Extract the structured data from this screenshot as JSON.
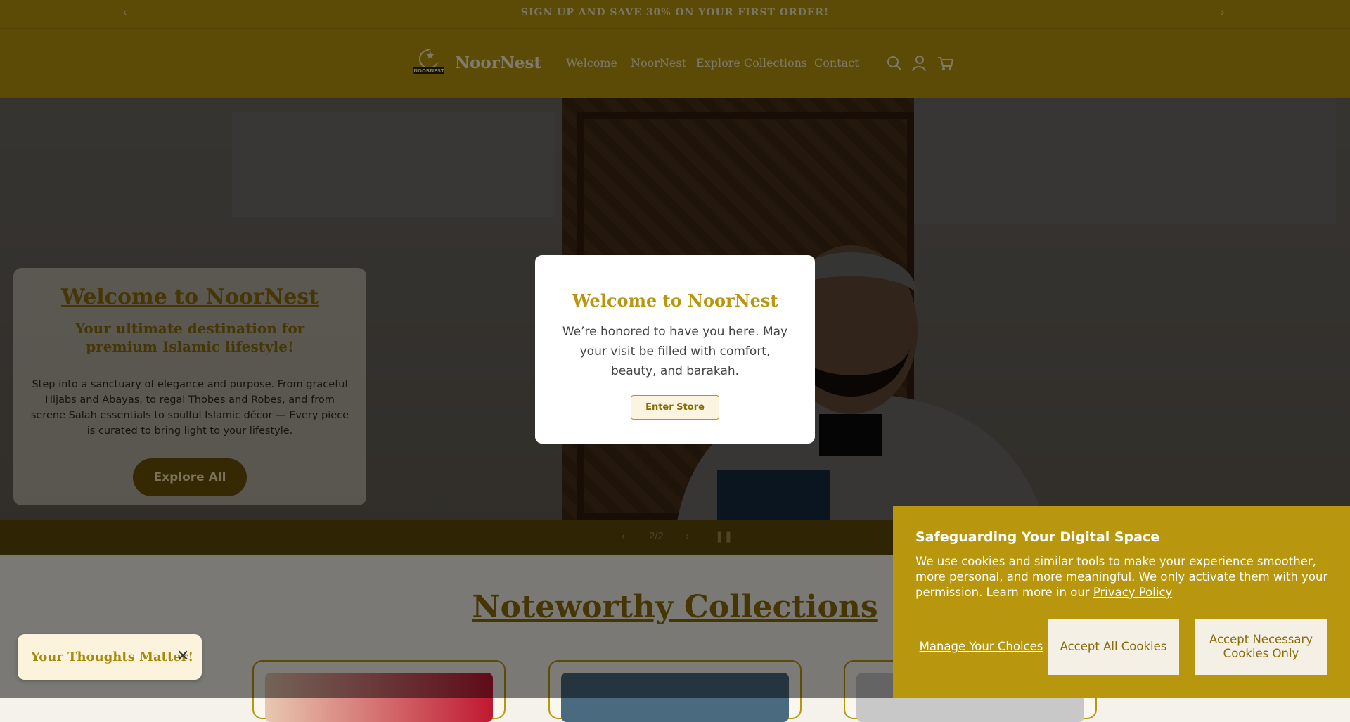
{
  "announcement": {
    "text": "SIGN UP AND SAVE 30% ON YOUR FIRST ORDER!",
    "prev": "‹",
    "next": "›"
  },
  "header": {
    "brand": "NoorNest",
    "logo_text": "NOORNEST",
    "nav": [
      "Welcome",
      "NoorNest",
      "Explore Collections",
      "Contact"
    ],
    "icons": [
      "search-icon",
      "account-icon",
      "cart-icon"
    ]
  },
  "hero": {
    "title": "Welcome to NoorNest",
    "subtitle": "Your ultimate destination for premium Islamic lifestyle!",
    "body": "Step into a sanctuary of elegance and purpose. From graceful Hijabs and Abayas, to regal Thobes and Robes, and from serene Salah essentials to soulful Islamic décor — Every piece is curated to bring light to your lifestyle.",
    "cta": "Explore All"
  },
  "slider": {
    "prev": "‹",
    "counter": "2/2",
    "next": "›",
    "pause": "❚❚"
  },
  "collections": {
    "title": "Noteworthy Collections"
  },
  "modal": {
    "title": "Welcome to NoorNest",
    "body": "We’re honored to have you here. May your visit be filled with comfort, beauty, and barakah.",
    "button": "Enter Store"
  },
  "feedback": {
    "label": "Your Thoughts Matter!",
    "close": "✕"
  },
  "cookie": {
    "title": "Safeguarding Your Digital Space",
    "body": "We use cookies and similar tools to make your experience smoother, more personal, and more meaningful. We only activate them with your permission. Learn more in our",
    "link": "Privacy Policy",
    "manage": "Manage Your Choices",
    "accept_all": "Accept All Cookies",
    "accept_necessary": "Accept Necessary Cookies Only"
  },
  "colors": {
    "brand": "#b8970f",
    "brand_dark": "#8a6c08",
    "light": "#f4f0e6"
  }
}
